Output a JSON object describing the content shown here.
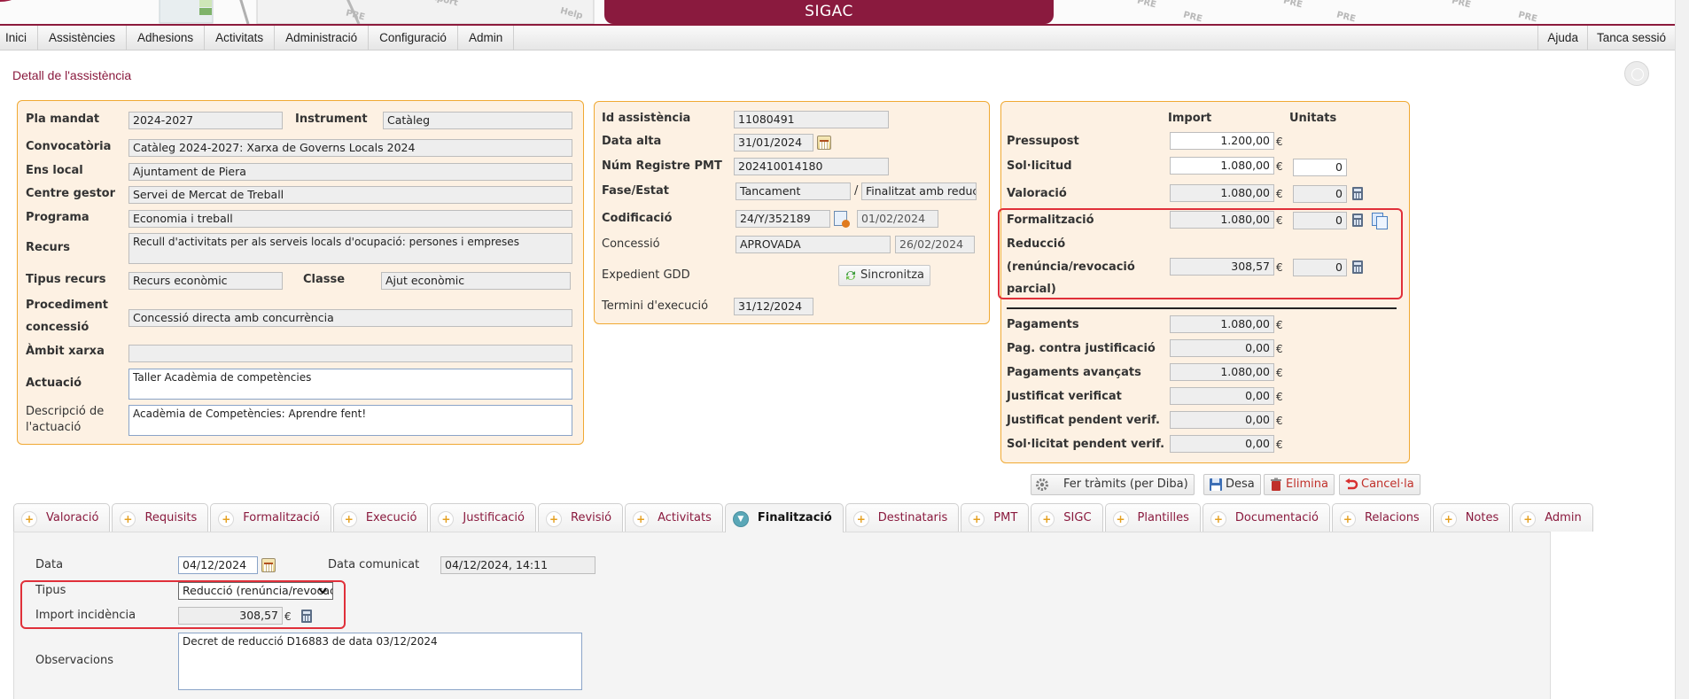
{
  "header": {
    "title": "SIGAC",
    "watermark": "PRE",
    "deco_labels": [
      "Export",
      "Help"
    ]
  },
  "menu": {
    "left": [
      "Inici",
      "Assistències",
      "Adhesions",
      "Activitats",
      "Administració",
      "Configuració",
      "Admin"
    ],
    "right": [
      "Ajuda",
      "Tanca sessió"
    ]
  },
  "page_title": "Detall de l'assistència",
  "left_panel": {
    "pla_mandat_label": "Pla mandat",
    "pla_mandat": "2024-2027",
    "instrument_label": "Instrument",
    "instrument": "Catàleg",
    "convocatoria_label": "Convocatòria",
    "convocatoria": "Catàleg 2024-2027: Xarxa de Governs Locals 2024",
    "ens_local_label": "Ens local",
    "ens_local": "Ajuntament de Piera",
    "centre_gestor_label": "Centre gestor",
    "centre_gestor": "Servei de Mercat de Treball",
    "programa_label": "Programa",
    "programa": "Economia i treball",
    "recurs_label": "Recurs",
    "recurs": "Recull d'activitats per als serveis locals d'ocupació: persones i empreses",
    "tipus_recurs_label": "Tipus recurs",
    "tipus_recurs": "Recurs econòmic",
    "classe_label": "Classe",
    "classe": "Ajut econòmic",
    "procediment_label_1": "Procediment",
    "procediment_label_2": "concessió",
    "procediment": "Concessió directa amb concurrència",
    "ambit_xarxa_label": "Àmbit xarxa",
    "ambit_xarxa": "",
    "actuacio_label": "Actuació",
    "actuacio": "Taller Acadèmia de competències",
    "descripcio_label_1": "Descripció de",
    "descripcio_label_2": "l'actuació",
    "descripcio": "Acadèmia de Competències: Aprendre fent!"
  },
  "middle_panel": {
    "id_label": "Id assistència",
    "id": "11080491",
    "data_alta_label": "Data alta",
    "data_alta": "31/01/2024",
    "num_registre_label": "Núm Registre PMT",
    "num_registre": "202410014180",
    "fase_label": "Fase/Estat",
    "fase": "Tancament",
    "estat": "Finalitzat amb reducció",
    "codificacio_label": "Codificació",
    "codificacio": "24/Y/352189",
    "codificacio_data": "01/02/2024",
    "concessio_label": "Concessió",
    "concessio": "APROVADA",
    "concessio_data": "26/02/2024",
    "expedient_label": "Expedient GDD",
    "sincronitza_label": "Sincronitza",
    "termini_label": "Termini d'execució",
    "termini": "31/12/2024"
  },
  "right_panel": {
    "import_header": "Import",
    "unitats_header": "Unitats",
    "currency": "€",
    "rows": [
      {
        "label": "Pressupost",
        "import": "1.200,00",
        "unitats": null
      },
      {
        "label": "Sol·licitud",
        "import": "1.080,00",
        "unitats": "0"
      },
      {
        "label": "Valoració",
        "import": "1.080,00",
        "unitats": "0"
      },
      {
        "label": "Formalització",
        "import": "1.080,00",
        "unitats": "0"
      }
    ],
    "reduccio_label_1": "Reducció",
    "reduccio_label_2": "(renúncia/revocació",
    "reduccio_label_3": "parcial)",
    "reduccio_import": "308,57",
    "reduccio_unitats": "0",
    "payments": [
      {
        "label": "Pagaments",
        "import": "1.080,00"
      },
      {
        "label": "Pag. contra justificació",
        "import": "0,00"
      },
      {
        "label": "Pagaments avançats",
        "import": "1.080,00"
      },
      {
        "label": "Justificat verificat",
        "import": "0,00"
      },
      {
        "label": "Justificat pendent verif.",
        "import": "0,00"
      },
      {
        "label": "Sol·licitat pendent verif.",
        "import": "0,00"
      }
    ]
  },
  "actions": {
    "tramits": "Fer tràmits (per Diba)",
    "desa": "Desa",
    "elimina": "Elimina",
    "cancel": "Cancel·la"
  },
  "tabs": [
    "Valoració",
    "Requisits",
    "Formalització",
    "Execució",
    "Justificació",
    "Revisió",
    "Activitats",
    "Finalització",
    "Destinataris",
    "PMT",
    "SIGC",
    "Plantilles",
    "Documentació",
    "Relacions",
    "Notes",
    "Admin"
  ],
  "active_tab": "Finalització",
  "finalitzacio": {
    "data_label": "Data",
    "data": "04/12/2024",
    "data_comunicat_label": "Data comunicat",
    "data_comunicat": "04/12/2024, 14:11",
    "tipus_label": "Tipus",
    "tipus": "Reducció (renúncia/revocació parcial)",
    "import_label": "Import incidència",
    "import": "308,57",
    "currency": "€",
    "observacions_label": "Observacions",
    "observacions": "Decret de reducció D16883 de data 03/12/2024"
  },
  "colors": {
    "brand": "#8a1a3e",
    "panel_bg": "#fdf1e3",
    "panel_border": "#f0a933",
    "highlight": "#e0303a"
  }
}
